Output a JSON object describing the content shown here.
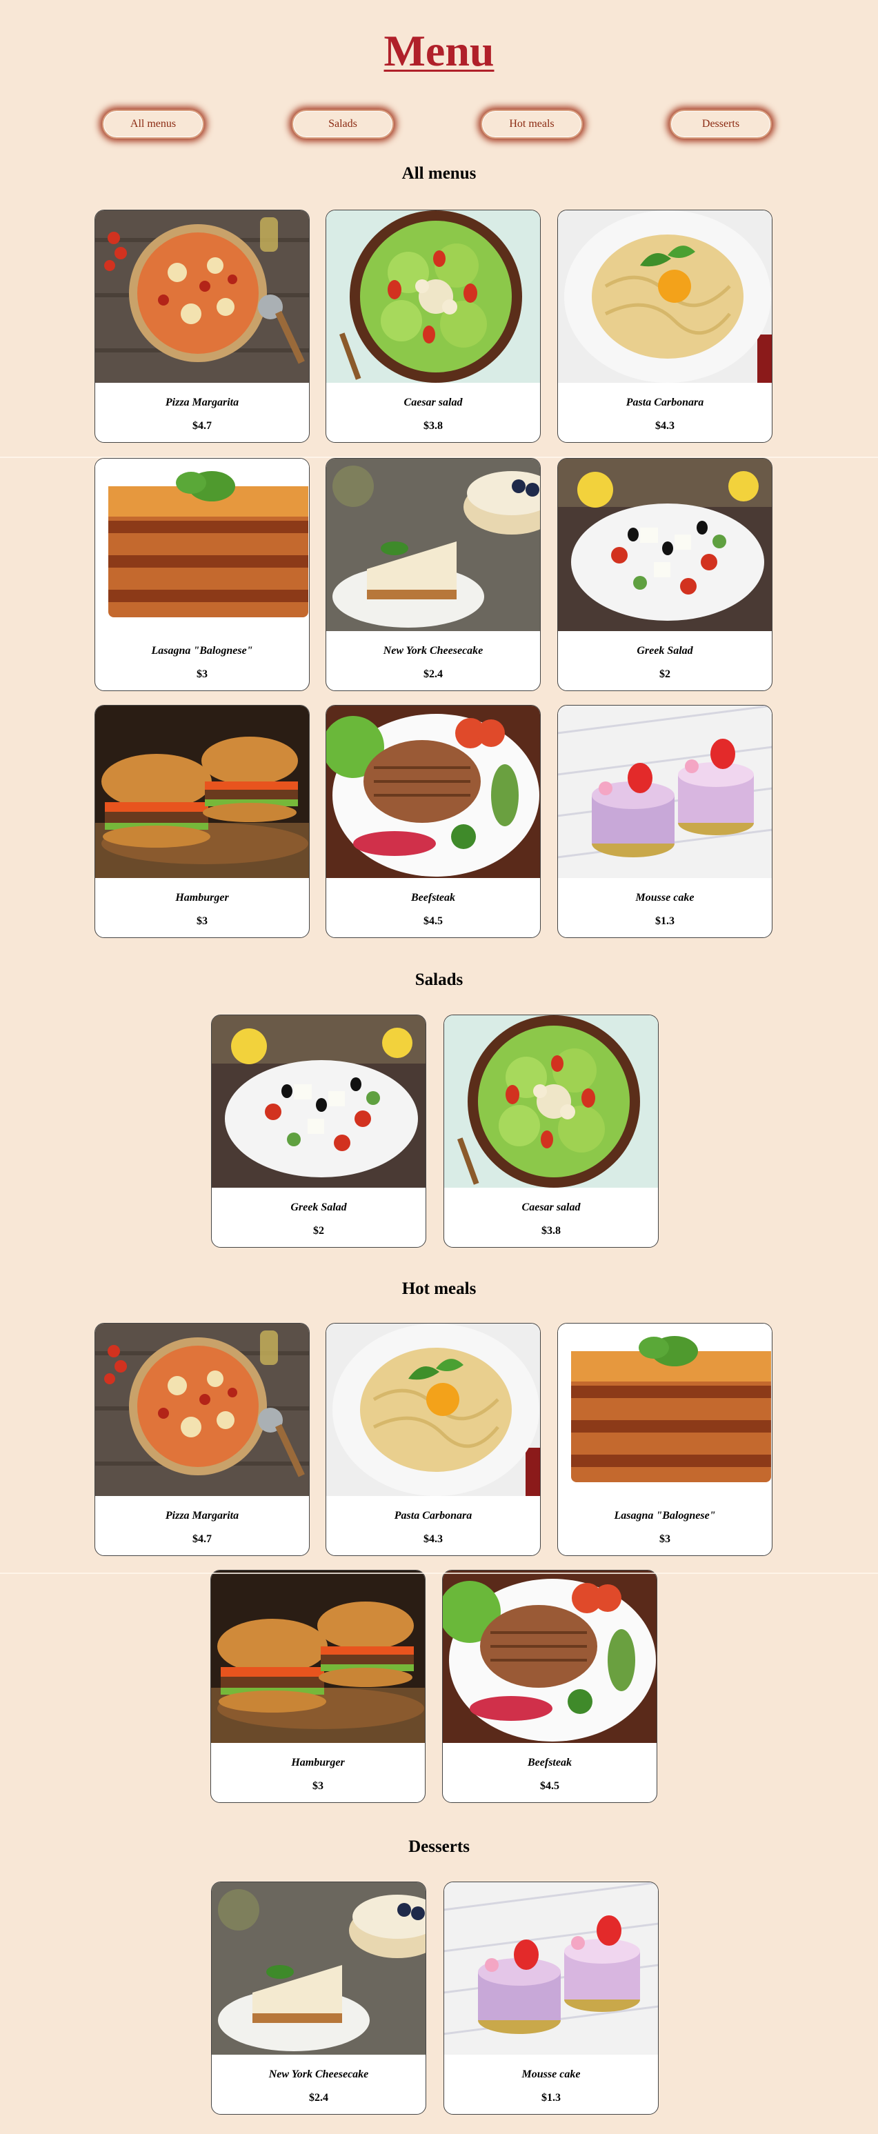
{
  "page": {
    "title": "Menu"
  },
  "nav": [
    {
      "label": "All menus"
    },
    {
      "label": "Salads"
    },
    {
      "label": "Hot meals"
    },
    {
      "label": "Desserts"
    }
  ],
  "sections": {
    "all": {
      "title": "All menus",
      "items": [
        {
          "name": "Pizza Margarita",
          "price": "$4.7",
          "image": "pizza-image"
        },
        {
          "name": "Caesar salad",
          "price": "$3.8",
          "image": "caesar-salad-image"
        },
        {
          "name": "Pasta Carbonara",
          "price": "$4.3",
          "image": "pasta-image"
        },
        {
          "name": "Lasagna \"Balognese\"",
          "price": "$3",
          "image": "lasagna-image"
        },
        {
          "name": "New York Cheesecake",
          "price": "$2.4",
          "image": "cheesecake-image"
        },
        {
          "name": "Greek Salad",
          "price": "$2",
          "image": "greek-salad-image"
        },
        {
          "name": "Hamburger",
          "price": "$3",
          "image": "hamburger-image"
        },
        {
          "name": "Beefsteak",
          "price": "$4.5",
          "image": "beefsteak-image"
        },
        {
          "name": "Mousse cake",
          "price": "$1.3",
          "image": "mousse-cake-image"
        }
      ]
    },
    "salads": {
      "title": "Salads",
      "items": [
        {
          "name": "Greek Salad",
          "price": "$2",
          "image": "greek-salad-image"
        },
        {
          "name": "Caesar salad",
          "price": "$3.8",
          "image": "caesar-salad-image"
        }
      ]
    },
    "hot": {
      "title": "Hot meals",
      "items": [
        {
          "name": "Pizza Margarita",
          "price": "$4.7",
          "image": "pizza-image"
        },
        {
          "name": "Pasta Carbonara",
          "price": "$4.3",
          "image": "pasta-image"
        },
        {
          "name": "Lasagna \"Balognese\"",
          "price": "$3",
          "image": "lasagna-image"
        },
        {
          "name": "Hamburger",
          "price": "$3",
          "image": "hamburger-image"
        },
        {
          "name": "Beefsteak",
          "price": "$4.5",
          "image": "beefsteak-image"
        }
      ]
    },
    "desserts": {
      "title": "Desserts",
      "items": [
        {
          "name": "New York Cheesecake",
          "price": "$2.4",
          "image": "cheesecake-image"
        },
        {
          "name": "Mousse cake",
          "price": "$1.3",
          "image": "mousse-cake-image"
        }
      ]
    }
  },
  "colors": {
    "background": "#f8e7d6",
    "title": "#b0202a",
    "button_text": "#8b2a12",
    "button_glow": "#a43a22"
  }
}
